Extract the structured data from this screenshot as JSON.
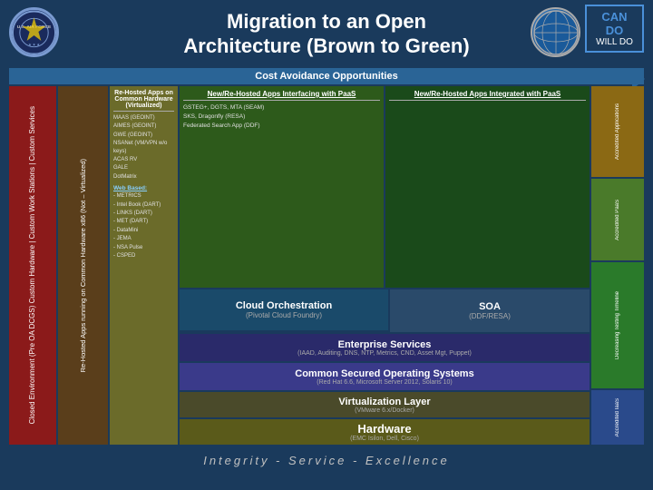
{
  "header": {
    "title_line1": "Migration to an Open",
    "title_line2": "Architecture (Brown to Green)",
    "can_do": "CAN DO",
    "will_do": "WILL DO"
  },
  "cost_avoidance": {
    "label": "Cost Avoidance Opportunities"
  },
  "left_sidebar": {
    "text": "Closed Environment (Pre OA DCGS) Custom Hardware | Custom Work Stations | Custom Services"
  },
  "rehost_hardware": {
    "text": "Re-Hosted Apps running on Common Hardware x86 (Not – Virtualized)"
  },
  "rehost_apps": {
    "title": "Re-Hosted Apps on Common Hardware (Virtualized)",
    "items": [
      "MAAS (GEOINT)",
      "AIMES (GEOINT)",
      "GWE (GEOINT)",
      "NSANet (VM/VPN w/o keys)",
      "ACAS RV",
      "GALE",
      "DotMatrix"
    ],
    "web_based_label": "Web Based:",
    "web_items": [
      "- METRICS",
      "- Intel Book (DART)",
      "- LINKS (DART)",
      "- MET (DART)",
      "- DataMini",
      "- JEMA",
      "- NSA Pulse",
      "- CSPED"
    ]
  },
  "new_rehosted_interfacing": {
    "title": "New/Re-Hosted Apps Interfacing with PaaS",
    "items": [
      "GSTEG+, DGTS, MTA (SEAM)",
      "SKS, Dragonfly (RESA)",
      "Federated Search App (DDF)"
    ]
  },
  "new_rehosted_integrated": {
    "title": "New/Re-Hosted Apps Integrated with PaaS"
  },
  "cloud_orchestration": {
    "title": "Cloud Orchestration",
    "subtitle": "(Pivotal Cloud Foundry)"
  },
  "soa": {
    "title": "SOA",
    "subtitle": "(DDF/RESA)"
  },
  "enterprise_services": {
    "title": "Enterprise Services",
    "subtitle": "(IAAD, Auditing, DNS, NTP, Metrics, CND, Asset Mgt, Puppet)"
  },
  "common_os": {
    "title": "Common Secured Operating Systems",
    "subtitle": "(Red Hat 6.6, Microsoft Server 2012, Solaris 10)"
  },
  "virt_layer": {
    "title": "Virtualization Layer",
    "subtitle": "(VMware 6.x/Docker)"
  },
  "hardware": {
    "title": "Hardware",
    "subtitle": "(EMC Isilon, Dell, Cisco)"
  },
  "accredited": {
    "applications": "Accredited Applications",
    "paas": "Accredited PaaS",
    "iaas": "Accredited IaaS",
    "timeline": "Decreasing Testing Timeline"
  },
  "footer": {
    "text": "Integrity - Service - Excellence"
  }
}
